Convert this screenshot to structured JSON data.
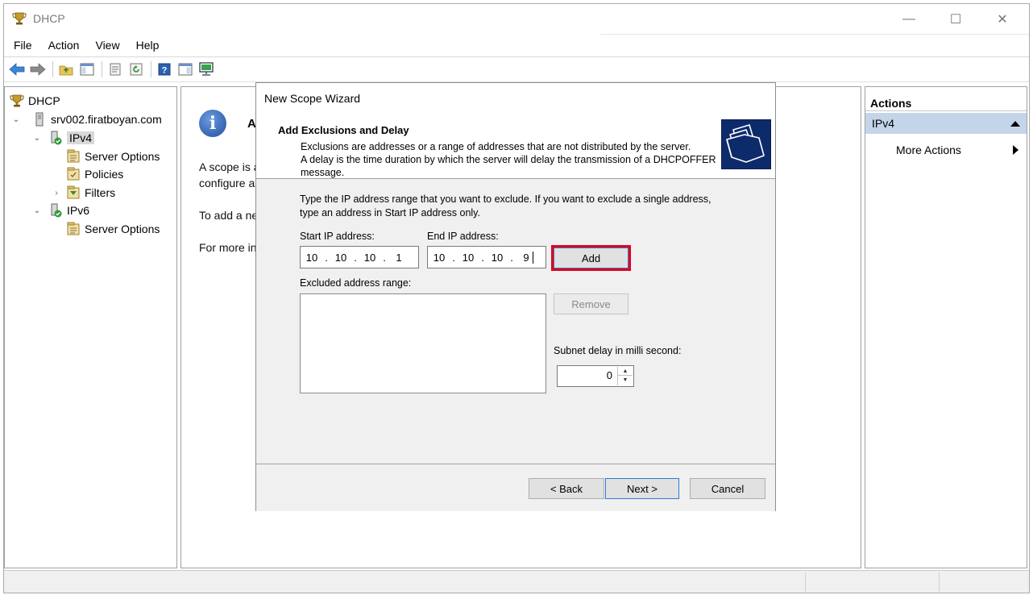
{
  "window": {
    "title": "DHCP",
    "controls": {
      "minimize": "—",
      "maximize": "☐",
      "close": "✕"
    }
  },
  "menu": [
    "File",
    "Action",
    "View",
    "Help"
  ],
  "tree": {
    "root": "DHCP",
    "server": "srv002.firatboyan.com",
    "ipv4": "IPv4",
    "ipv4_children": [
      "Server Options",
      "Policies",
      "Filters"
    ],
    "ipv6": "IPv6",
    "ipv6_children": [
      "Server Options"
    ]
  },
  "middle": {
    "heading": "A",
    "line1": "A scope is a",
    "line2": "configure a",
    "line3": "To add a ne",
    "line4": "For more in"
  },
  "actions": {
    "title": "Actions",
    "group": "IPv4",
    "item": "More Actions"
  },
  "wizard": {
    "title": "New Scope Wizard",
    "header_title": "Add Exclusions and Delay",
    "header_desc_1": "Exclusions are addresses or a range of addresses that are not distributed by the server.",
    "header_desc_2": "A delay is the time duration by which the server will delay the transmission of a DHCPOFFER message.",
    "instruction": "Type the IP address range that you want to exclude. If you want to exclude a single address, type an address in Start IP address only.",
    "start_label": "Start IP address:",
    "end_label": "End IP address:",
    "start_ip": [
      "10",
      "10",
      "10",
      "1"
    ],
    "end_ip": [
      "10",
      "10",
      "10",
      "9"
    ],
    "add_button": "Add",
    "excluded_label": "Excluded address range:",
    "remove_button": "Remove",
    "delay_label": "Subnet delay in milli second:",
    "delay_value": "0",
    "back_button": "< Back",
    "next_button": "Next >",
    "cancel_button": "Cancel"
  },
  "colors": {
    "highlight": "#e0001a",
    "action_group_bg": "#c4d5ea",
    "wizard_logo_bg": "#0d2a6b"
  }
}
